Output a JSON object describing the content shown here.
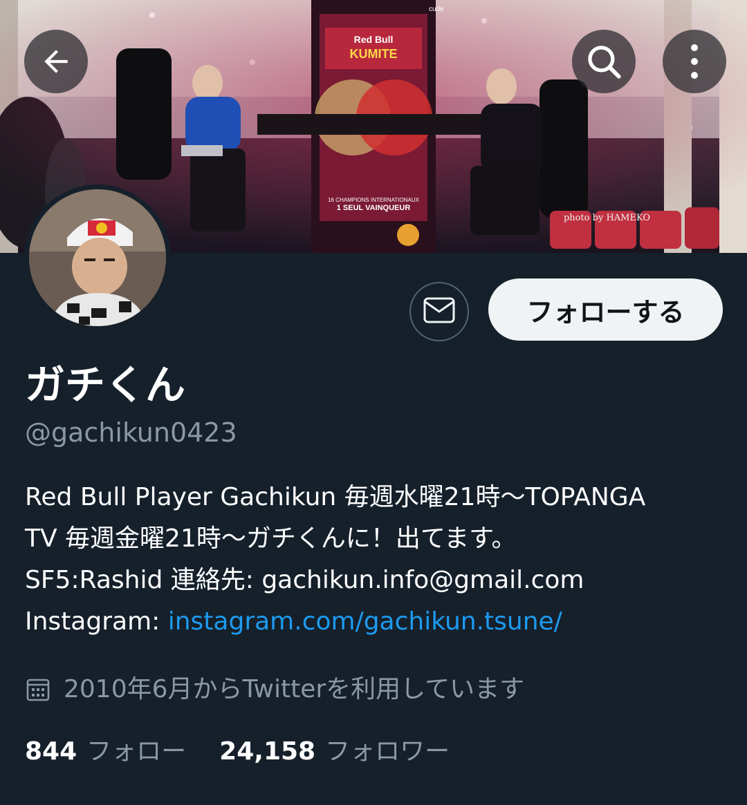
{
  "header": {
    "back_icon": "arrow-left-icon",
    "search_icon": "search-icon",
    "more_icon": "more-vertical-icon",
    "photo_credit": "photo by HAMEKO",
    "banner_texts": {
      "event_line1": "16 CHAMPIONS INTERNATIONAUX",
      "event_line2": "1 SEUL VAINQUEUR",
      "logo_top": "Red Bull",
      "logo_bottom": "KUMITE",
      "cube": "cude"
    }
  },
  "profile": {
    "display_name": "ガチくん",
    "handle": "@gachikun0423",
    "follow_label": "フォローする",
    "message_icon": "mail-icon",
    "bio": {
      "line1": "Red Bull Player Gachikun 毎週水曜21時〜TOPANGA",
      "line2": "TV 毎週金曜21時〜ガチくんに！出てます。",
      "line3": "SF5:Rashid 連絡先: gachikun.info@gmail.com",
      "line4_prefix": "Instagram: ",
      "line4_link": "instagram.com/gachikun.tsune/"
    },
    "joined": "2010年6月からTwitterを利用しています",
    "joined_icon": "calendar-icon",
    "following_count": "844",
    "following_label": "フォロー",
    "followers_count": "24,158",
    "followers_label": "フォロワー"
  },
  "colors": {
    "background": "#15202b",
    "link": "#1d9bf0",
    "secondary_text": "#8b98a5",
    "follow_button_bg": "#eff3f4"
  }
}
